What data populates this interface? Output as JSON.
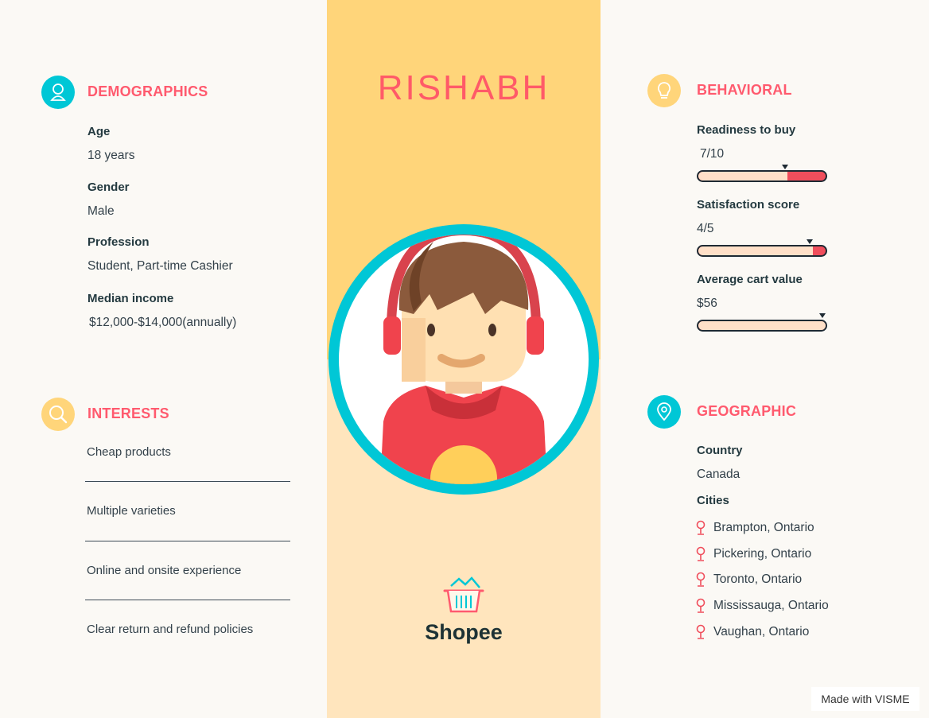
{
  "persona": {
    "name": "RISHABH",
    "brand": "Shopee"
  },
  "demographics": {
    "title": "DEMOGRAPHICS",
    "icon": "person-icon",
    "age_label": "Age",
    "age": "18 years",
    "gender_label": "Gender",
    "gender": "Male",
    "profession_label": "Profession",
    "profession": "Student, Part-time Cashier",
    "income_label": "Median income",
    "income": "$12,000-$14,000(annually)"
  },
  "interests": {
    "title": "INTERESTS",
    "icon": "search-icon",
    "items": [
      "Cheap products",
      "Multiple varieties",
      "Online and onsite experience",
      "Clear return and refund policies"
    ]
  },
  "behavioral": {
    "title": "BEHAVIORAL",
    "icon": "lightbulb-icon",
    "metrics": [
      {
        "label": "Readiness to buy",
        "value": "7/10",
        "level": 0.7
      },
      {
        "label": "Satisfaction score",
        "value": "4/5",
        "level": 0.9
      },
      {
        "label": "Average cart value",
        "value": "$56",
        "level": 1.0
      }
    ]
  },
  "geographic": {
    "title": "GEOGRAPHIC",
    "icon": "location-pin-icon",
    "country_label": "Country",
    "country": "Canada",
    "cities_label": "Cities",
    "cities": [
      "Brampton, Ontario",
      "Pickering, Ontario",
      "Toronto, Ontario",
      "Mississauga, Ontario",
      "Vaughan, Ontario"
    ]
  },
  "colors": {
    "accent": "#ff5a6e",
    "teal": "#00c7d6",
    "yellow": "#ffd57a",
    "cream": "#ffe5bd"
  },
  "footer": {
    "badge": "Made with VISME"
  }
}
